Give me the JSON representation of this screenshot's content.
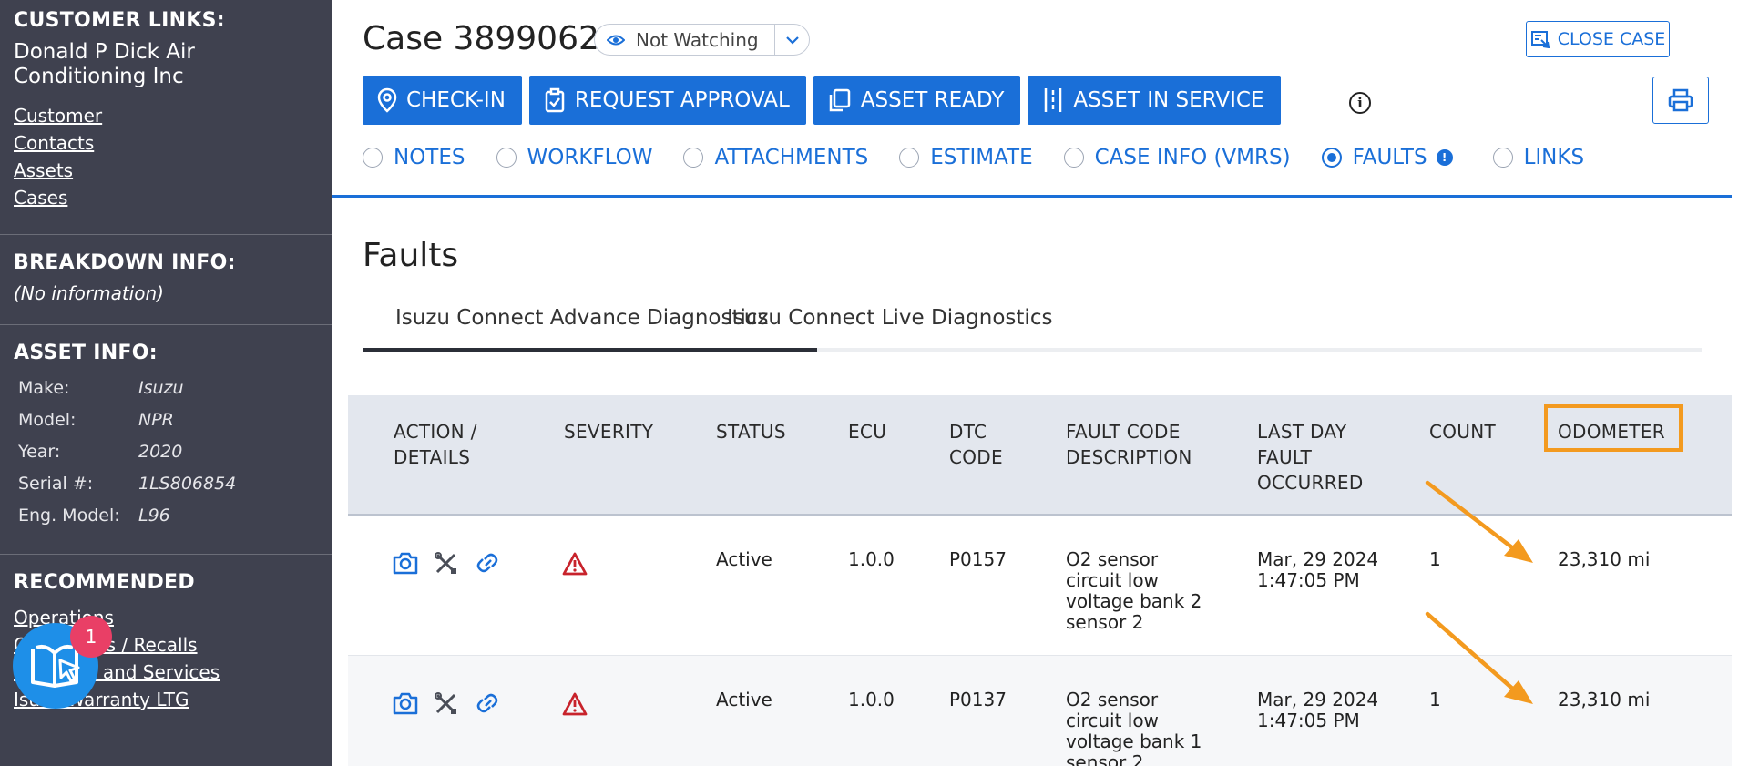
{
  "sidebar": {
    "customer_links_heading": "CUSTOMER LINKS:",
    "company_name": "Donald P Dick Air Conditioning Inc",
    "links": [
      "Customer",
      "Contacts",
      "Assets",
      "Cases"
    ],
    "breakdown_heading": "BREAKDOWN INFO:",
    "breakdown_value": "(No information)",
    "asset_heading": "ASSET INFO:",
    "asset_info": [
      {
        "label": "Make:",
        "value": "Isuzu"
      },
      {
        "label": "Model:",
        "value": "NPR"
      },
      {
        "label": "Year:",
        "value": "2020"
      },
      {
        "label": "Serial #:",
        "value": "1LS806854"
      },
      {
        "label": "Eng. Model:",
        "value": "L96"
      }
    ],
    "recommended_heading": "RECOMMENDED",
    "recommended_links": [
      "Operations",
      "Campaigns / Recalls",
      "Warranty and Services",
      "Isuzu Warranty LTG"
    ]
  },
  "help_widget": {
    "badge_count": "1",
    "icon": "book-cursor-icon"
  },
  "header": {
    "case_title": "Case 3899062",
    "watch_label": "Not Watching",
    "close_case_label": "CLOSE CASE"
  },
  "actions": [
    {
      "label": "CHECK-IN",
      "icon": "location-pin-icon"
    },
    {
      "label": "REQUEST APPROVAL",
      "icon": "clipboard-check-icon"
    },
    {
      "label": "ASSET READY",
      "icon": "asset-ready-icon"
    },
    {
      "label": "ASSET IN SERVICE",
      "icon": "asset-service-icon"
    }
  ],
  "tabs": [
    {
      "label": "NOTES",
      "selected": false
    },
    {
      "label": "WORKFLOW",
      "selected": false
    },
    {
      "label": "ATTACHMENTS",
      "selected": false
    },
    {
      "label": "ESTIMATE",
      "selected": false
    },
    {
      "label": "CASE INFO (VMRS)",
      "selected": false
    },
    {
      "label": "FAULTS",
      "selected": true
    },
    {
      "label": "LINKS",
      "selected": false
    }
  ],
  "faults": {
    "title": "Faults",
    "sub_tabs": [
      "Isuzu Connect Advance Diagnostics",
      "Isuzu Connect Live Diagnostics"
    ],
    "columns": [
      "ACTION / DETAILS",
      "SEVERITY",
      "STATUS",
      "ECU",
      "DTC CODE",
      "FAULT CODE DESCRIPTION",
      "LAST DAY FAULT OCCURRED",
      "COUNT",
      "ODOMETER"
    ],
    "rows": [
      {
        "status": "Active",
        "ecu": "1.0.0",
        "dtc": "P0157",
        "description": "O2 sensor circuit low voltage bank 2 sensor 2",
        "last_day": "Mar, 29 2024 1:47:05 PM",
        "count": "1",
        "odometer": "23,310 mi"
      },
      {
        "status": "Active",
        "ecu": "1.0.0",
        "dtc": "P0137",
        "description": "O2 sensor circuit low voltage bank 1 sensor 2",
        "last_day": "Mar, 29 2024 1:47:05 PM",
        "count": "1",
        "odometer": "23,310 mi"
      }
    ]
  },
  "colors": {
    "accent": "#1a6fd8",
    "sidebar": "#3f414f",
    "highlight": "#f39a1f",
    "severity": "#c8232c"
  }
}
